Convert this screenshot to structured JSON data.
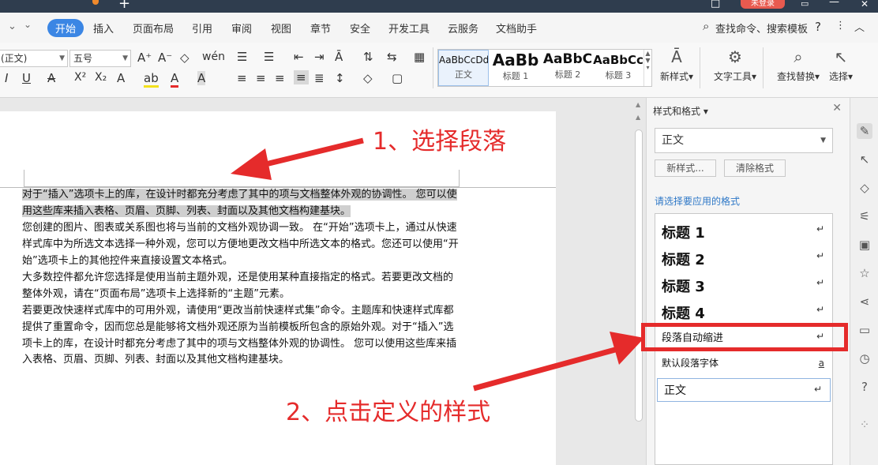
{
  "titlebar": {
    "plus": "+",
    "login": "未登录",
    "min": "□",
    "close": "✕"
  },
  "tabs": [
    "开始",
    "插入",
    "页面布局",
    "引用",
    "审阅",
    "视图",
    "章节",
    "安全",
    "开发工具",
    "云服务",
    "文档助手"
  ],
  "search": {
    "label": "查找命令、搜索模板",
    "help": "?"
  },
  "ribbon": {
    "font_name": "(正文)",
    "font_size": "五号",
    "styles": [
      {
        "preview": "AaBbCcDd",
        "name": "正文"
      },
      {
        "preview": "AaBb",
        "name": "标题 1"
      },
      {
        "preview": "AaBbC",
        "name": "标题 2"
      },
      {
        "preview": "AaBbCc",
        "name": "标题 3"
      }
    ],
    "new_style": "新样式",
    "text_tool": "文字工具",
    "find_replace": "查找替换",
    "select": "选择"
  },
  "document": {
    "p1": "对于“插入”选项卡上的库，在设计时都充分考虑了其中的项与文档整体外观的协调性。 您可以使用这些库来插入表格、页眉、页脚、列表、封面以及其他文档构建基块。",
    "p2": "您创建的图片、图表或关系图也将与当前的文档外观协调一致。 在“开始”选项卡上，通过从快速样式库中为所选文本选择一种外观，您可以方便地更改文档中所选文本的格式。您还可以使用“开始”选项卡上的其他控件来直接设置文本格式。",
    "p3": "大多数控件都允许您选择是使用当前主题外观，还是使用某种直接指定的格式。若要更改文档的整体外观，请在“页面布局”选项卡上选择新的“主题”元素。",
    "p4": "若要更改快速样式库中的可用外观，请使用“更改当前快速样式集”命令。主题库和快速样式库都提供了重置命令，因而您总是能够将文档外观还原为当前模板所包含的原始外观。对于“插入”选项卡上的库，在设计时都充分考虑了其中的项与文档整体外观的协调性。 您可以使用这些库来插入表格、页眉、页脚、列表、封面以及其他文档构建基块。"
  },
  "panel": {
    "title": "样式和格式",
    "current": "正文",
    "new_btn": "新样式...",
    "clear_btn": "清除格式",
    "apply_label": "请选择要应用的格式",
    "items": [
      {
        "label": "标题 1",
        "mark": "↵"
      },
      {
        "label": "标题 2",
        "mark": "↵"
      },
      {
        "label": "标题 3",
        "mark": "↵"
      },
      {
        "label": "标题 4",
        "mark": "↵"
      },
      {
        "label": "段落自动缩进",
        "mark": "↵"
      },
      {
        "label": "默认段落字体",
        "mark": "a"
      },
      {
        "label": "正文",
        "mark": "↵"
      }
    ]
  },
  "annotations": {
    "step1": "1、选择段落",
    "step2": "2、点击定义的样式"
  },
  "colors": {
    "accent": "#3b86e4",
    "annotation_red": "#e52b2b",
    "titlebar": "#2f3d4e"
  }
}
